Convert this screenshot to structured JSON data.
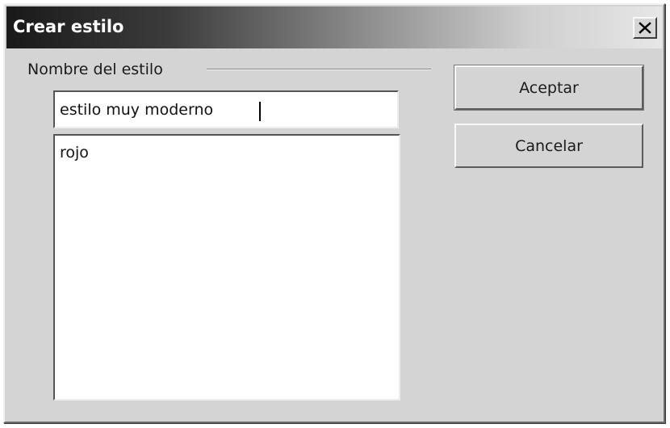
{
  "window": {
    "title": "Crear estilo",
    "close_label": "Close"
  },
  "form": {
    "group_label": "Nombre del estilo",
    "name_value": "estilo muy moderno",
    "styles": [
      "rojo"
    ]
  },
  "buttons": {
    "ok_label": "Aceptar",
    "cancel_label": "Cancelar"
  },
  "icons": {
    "close": "close-icon"
  },
  "colors": {
    "title_text": "#ffffff",
    "dialog_bg": "#d4d4d4",
    "titlebar_start": "#191919",
    "titlebar_end": "#e6e6e6"
  }
}
